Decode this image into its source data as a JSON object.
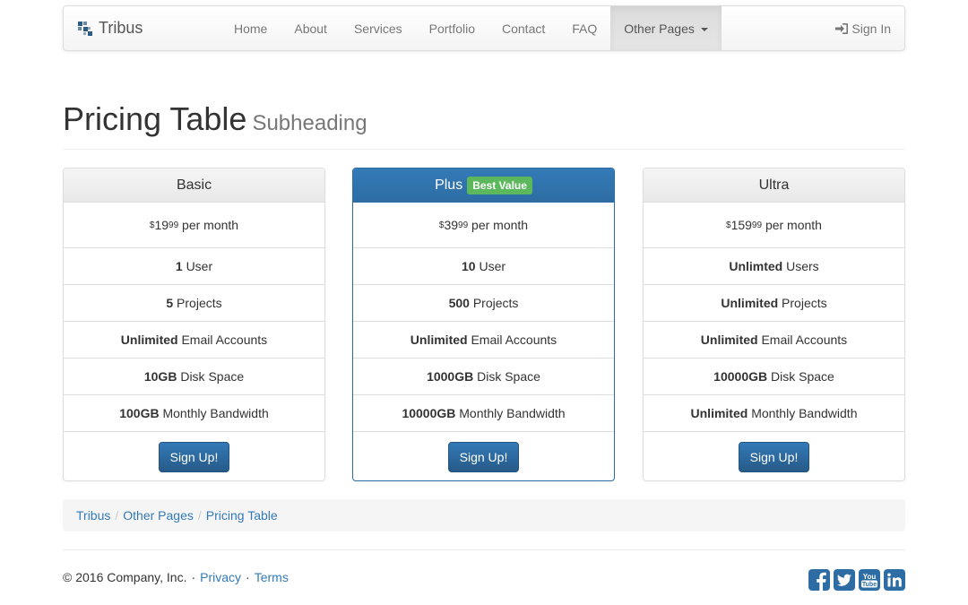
{
  "navbar": {
    "brand": "Tribus",
    "links": [
      "Home",
      "About",
      "Services",
      "Portfolio",
      "Contact",
      "FAQ"
    ],
    "dropdown": "Other Pages",
    "signin": "Sign In"
  },
  "header": {
    "title": "Pricing Table",
    "subtitle": "Subheading"
  },
  "plans": [
    {
      "name": "Basic",
      "currency": "$",
      "price_main": "19",
      "price_cents": "99",
      "period": "per month",
      "features": [
        {
          "bold": "1",
          "rest": "User"
        },
        {
          "bold": "5",
          "rest": "Projects"
        },
        {
          "bold": "Unlimited",
          "rest": "Email Accounts"
        },
        {
          "bold": "10GB",
          "rest": "Disk Space"
        },
        {
          "bold": "100GB",
          "rest": "Monthly Bandwidth"
        }
      ],
      "button": "Sign Up!"
    },
    {
      "name": "Plus",
      "badge": "Best Value",
      "currency": "$",
      "price_main": "39",
      "price_cents": "99",
      "period": "per month",
      "features": [
        {
          "bold": "10",
          "rest": "User"
        },
        {
          "bold": "500",
          "rest": "Projects"
        },
        {
          "bold": "Unlimited",
          "rest": "Email Accounts"
        },
        {
          "bold": "1000GB",
          "rest": "Disk Space"
        },
        {
          "bold": "10000GB",
          "rest": "Monthly Bandwidth"
        }
      ],
      "button": "Sign Up!"
    },
    {
      "name": "Ultra",
      "currency": "$",
      "price_main": "159",
      "price_cents": "99",
      "period": "per month",
      "features": [
        {
          "bold": "Unlimted",
          "rest": "Users"
        },
        {
          "bold": "Unlimited",
          "rest": "Projects"
        },
        {
          "bold": "Unlimited",
          "rest": "Email Accounts"
        },
        {
          "bold": "10000GB",
          "rest": "Disk Space"
        },
        {
          "bold": "Unlimited",
          "rest": "Monthly Bandwidth"
        }
      ],
      "button": "Sign Up!"
    }
  ],
  "breadcrumb": [
    "Tribus",
    "Other Pages",
    "Pricing Table"
  ],
  "footer": {
    "copyright": "© 2016 Company, Inc.",
    "privacy": "Privacy",
    "terms": "Terms",
    "social_icons": [
      "facebook-icon",
      "twitter-icon",
      "youtube-icon",
      "linkedin-icon"
    ]
  },
  "colors": {
    "primary": "#337ab7",
    "badge": "#5cb85c",
    "social": "#2e6da4"
  }
}
